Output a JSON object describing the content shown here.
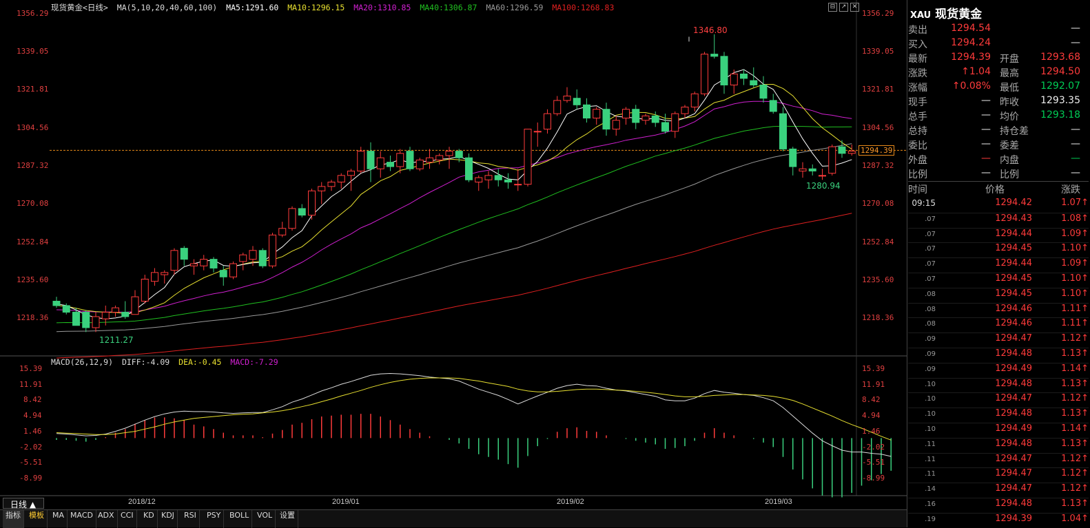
{
  "header": {
    "title": "现货黄金<日线>",
    "ma_params": "MA(5,10,20,40,60,100)",
    "ma5": "MA5:1291.60",
    "ma10": "MA10:1296.15",
    "ma20": "MA20:1310.85",
    "ma40": "MA40:1306.87",
    "ma60": "MA60:1296.59",
    "ma100": "MA100:1268.83"
  },
  "macd_header": {
    "params": "MACD(26,12,9)",
    "diff": "DIFF:-4.09",
    "dea": "DEA:-0.45",
    "macd": "MACD:-7.29"
  },
  "colors": {
    "up": "#ff3b3b",
    "down": "#3ad17e",
    "ma5": "#ffffff",
    "ma10": "#e8e030",
    "ma20": "#d020d0",
    "ma40": "#20c020",
    "ma60": "#9a9a9a",
    "ma100": "#e02020",
    "dea": "#e8e030"
  },
  "chart_data": {
    "type": "candlestick",
    "y_ticks": [
      "1356.29",
      "1339.05",
      "1321.81",
      "1304.56",
      "1287.32",
      "1270.08",
      "1252.84",
      "1235.60",
      "1218.36"
    ],
    "ylim": [
      1205.0,
      1357.5
    ],
    "x_labels": [
      "2018/12",
      "2019/01",
      "2019/02",
      "2019/03"
    ],
    "high_marker": "1346.80",
    "low_marker_left": "1211.27",
    "low_marker_right": "1280.94",
    "current_price": "1294.39",
    "macd_ticks": [
      "15.39",
      "11.91",
      "8.42",
      "4.94",
      "1.46",
      "-2.02",
      "-5.51",
      "-8.99"
    ],
    "macd_ylim": [
      -10.5,
      15.9
    ],
    "candles": [
      [
        1226,
        1228,
        1223,
        1224
      ],
      [
        1224,
        1225,
        1220,
        1221
      ],
      [
        1221,
        1223,
        1215,
        1215
      ],
      [
        1221,
        1222,
        1212,
        1214
      ],
      [
        1214,
        1221,
        1212,
        1219
      ],
      [
        1218,
        1224,
        1215,
        1221
      ],
      [
        1221,
        1224,
        1219,
        1223
      ],
      [
        1221,
        1226,
        1218,
        1219
      ],
      [
        1220,
        1231,
        1220,
        1228
      ],
      [
        1226,
        1238,
        1225,
        1236
      ],
      [
        1235,
        1241,
        1233,
        1239
      ],
      [
        1238,
        1240,
        1234,
        1239
      ],
      [
        1240,
        1250,
        1238,
        1249
      ],
      [
        1250,
        1251,
        1242,
        1245
      ],
      [
        1242,
        1245,
        1238,
        1243
      ],
      [
        1242,
        1247,
        1240,
        1245
      ],
      [
        1245,
        1246,
        1239,
        1241
      ],
      [
        1240,
        1242,
        1233,
        1237
      ],
      [
        1237,
        1244,
        1236,
        1243
      ],
      [
        1244,
        1248,
        1240,
        1247
      ],
      [
        1245,
        1251,
        1242,
        1249
      ],
      [
        1249,
        1250,
        1241,
        1242
      ],
      [
        1242,
        1257,
        1241,
        1256
      ],
      [
        1256,
        1262,
        1255,
        1259
      ],
      [
        1259,
        1269,
        1258,
        1268
      ],
      [
        1268,
        1270,
        1264,
        1265
      ],
      [
        1265,
        1277,
        1263,
        1276
      ],
      [
        1276,
        1280,
        1270,
        1278
      ],
      [
        1278,
        1281,
        1276,
        1280
      ],
      [
        1280,
        1284,
        1277,
        1283
      ],
      [
        1283,
        1286,
        1276,
        1285
      ],
      [
        1285,
        1296,
        1284,
        1294
      ],
      [
        1294,
        1298,
        1280,
        1286
      ],
      [
        1286,
        1294,
        1282,
        1291
      ],
      [
        1289,
        1292,
        1285,
        1287
      ],
      [
        1287,
        1295,
        1284,
        1293
      ],
      [
        1294,
        1296,
        1285,
        1286
      ],
      [
        1286,
        1291,
        1285,
        1290
      ],
      [
        1289,
        1295,
        1286,
        1291
      ],
      [
        1290,
        1293,
        1288,
        1292
      ],
      [
        1292,
        1296,
        1286,
        1294
      ],
      [
        1294,
        1295,
        1289,
        1291
      ],
      [
        1291,
        1293,
        1280,
        1281
      ],
      [
        1280,
        1283,
        1276,
        1282
      ],
      [
        1281,
        1285,
        1277,
        1283
      ],
      [
        1283,
        1286,
        1278,
        1281
      ],
      [
        1281,
        1284,
        1277,
        1280
      ],
      [
        1279,
        1286,
        1276,
        1279
      ],
      [
        1279,
        1304,
        1278,
        1304
      ],
      [
        1303,
        1307,
        1296,
        1303
      ],
      [
        1304,
        1313,
        1302,
        1311
      ],
      [
        1311,
        1319,
        1310,
        1317
      ],
      [
        1317,
        1323,
        1316,
        1319
      ],
      [
        1318,
        1322,
        1313,
        1315
      ],
      [
        1315,
        1318,
        1307,
        1309
      ],
      [
        1309,
        1314,
        1306,
        1313
      ],
      [
        1313,
        1316,
        1301,
        1304
      ],
      [
        1304,
        1310,
        1301,
        1308
      ],
      [
        1309,
        1314,
        1306,
        1313
      ],
      [
        1313,
        1315,
        1304,
        1307
      ],
      [
        1308,
        1311,
        1306,
        1310
      ],
      [
        1310,
        1312,
        1305,
        1307
      ],
      [
        1307,
        1311,
        1302,
        1303
      ],
      [
        1303,
        1312,
        1300,
        1311
      ],
      [
        1311,
        1315,
        1309,
        1314
      ],
      [
        1314,
        1321,
        1312,
        1320
      ],
      [
        1320,
        1339,
        1319,
        1338
      ],
      [
        1338,
        1347,
        1336,
        1337
      ],
      [
        1337,
        1339,
        1320,
        1324
      ],
      [
        1324,
        1331,
        1320,
        1329
      ],
      [
        1329,
        1331,
        1324,
        1327
      ],
      [
        1326,
        1332,
        1323,
        1324
      ],
      [
        1324,
        1328,
        1316,
        1318
      ],
      [
        1317,
        1320,
        1311,
        1312
      ],
      [
        1311,
        1314,
        1294,
        1295
      ],
      [
        1295,
        1296,
        1283,
        1287
      ],
      [
        1285,
        1289,
        1282,
        1286
      ],
      [
        1286,
        1288,
        1283,
        1285
      ],
      [
        1283,
        1286,
        1281,
        1283
      ],
      [
        1284,
        1297,
        1283,
        1296
      ],
      [
        1296,
        1299,
        1291,
        1293
      ],
      [
        1293,
        1297,
        1292,
        1294
      ]
    ],
    "macd_diff": [
      1.0,
      0.9,
      0.7,
      0.5,
      0.6,
      0.9,
      1.5,
      2.2,
      3.1,
      4.0,
      4.8,
      5.4,
      5.8,
      6.0,
      5.9,
      5.9,
      5.8,
      5.6,
      5.5,
      5.6,
      5.7,
      5.7,
      6.3,
      7.0,
      8.0,
      8.7,
      9.6,
      10.5,
      11.2,
      12.0,
      12.6,
      13.3,
      14.0,
      14.3,
      14.4,
      14.3,
      14.1,
      13.9,
      13.6,
      13.4,
      13.2,
      12.7,
      11.8,
      10.9,
      10.2,
      9.5,
      8.6,
      7.6,
      8.5,
      9.4,
      10.2,
      11.1,
      11.7,
      12.0,
      11.7,
      11.6,
      11.1,
      10.7,
      10.5,
      10.1,
      9.7,
      9.3,
      8.5,
      8.3,
      8.3,
      8.9,
      9.9,
      10.6,
      10.2,
      10.0,
      9.7,
      9.5,
      9.0,
      8.3,
      6.8,
      4.9,
      3.0,
      1.1,
      -0.6,
      -1.7,
      -2.7,
      -3.1,
      -3.1,
      -3.4,
      -3.6,
      -4.09
    ],
    "macd_dea": [
      1.2,
      1.1,
      1.0,
      0.9,
      0.8,
      0.8,
      0.9,
      1.2,
      1.5,
      2.0,
      2.5,
      3.1,
      3.6,
      4.0,
      4.4,
      4.6,
      4.8,
      5.0,
      5.2,
      5.3,
      5.4,
      5.6,
      5.8,
      6.1,
      6.5,
      7.0,
      7.5,
      8.1,
      8.7,
      9.4,
      10.0,
      10.6,
      11.3,
      11.9,
      12.4,
      12.8,
      13.1,
      13.3,
      13.4,
      13.4,
      13.4,
      13.3,
      13.0,
      12.7,
      12.3,
      11.9,
      11.5,
      10.9,
      10.5,
      10.3,
      10.3,
      10.4,
      10.6,
      10.8,
      10.9,
      10.9,
      10.8,
      10.7,
      10.6,
      10.4,
      10.2,
      10.0,
      9.7,
      9.4,
      9.2,
      9.2,
      9.3,
      9.5,
      9.6,
      9.7,
      9.7,
      9.6,
      9.5,
      9.3,
      8.9,
      8.4,
      7.6,
      6.7,
      5.8,
      4.9,
      3.9,
      3.0,
      2.2,
      1.3,
      0.4,
      -0.45
    ]
  },
  "quote": {
    "symbol": "XAU",
    "name": "现货黄金",
    "rows": [
      {
        "a": "卖出",
        "b": "1294.54",
        "bc": "red",
        "c": "",
        "d": "—",
        "dc": "wht"
      },
      {
        "a": "买入",
        "b": "1294.24",
        "bc": "red",
        "c": "",
        "d": "—",
        "dc": "wht"
      },
      {
        "a": "最新",
        "b": "1294.39",
        "bc": "red",
        "c": "开盘",
        "d": "1293.68",
        "dc": "red"
      },
      {
        "a": "涨跌",
        "b": "↑1.04",
        "bc": "red",
        "c": "最高",
        "d": "1294.50",
        "dc": "red"
      },
      {
        "a": "涨幅",
        "b": "↑0.08%",
        "bc": "red",
        "c": "最低",
        "d": "1292.07",
        "dc": "grn"
      },
      {
        "a": "现手",
        "b": "—",
        "bc": "wht",
        "c": "昨收",
        "d": "1293.35",
        "dc": "wht"
      },
      {
        "a": "总手",
        "b": "—",
        "bc": "wht",
        "c": "均价",
        "d": "1293.18",
        "dc": "grn"
      },
      {
        "a": "总持",
        "b": "—",
        "bc": "wht",
        "c": "持仓差",
        "d": "—",
        "dc": "wht"
      },
      {
        "a": "委比",
        "b": "—",
        "bc": "wht",
        "c": "委差",
        "d": "—",
        "dc": "wht"
      },
      {
        "a": "外盘",
        "b": "—",
        "bc": "red",
        "c": "内盘",
        "d": "—",
        "dc": "grn"
      },
      {
        "a": "比例",
        "b": "—",
        "bc": "wht",
        "c": "比例",
        "d": "—",
        "dc": "wht"
      }
    ],
    "ticks_header": {
      "time": "时间",
      "price": "价格",
      "change": "涨跌"
    },
    "ticks": [
      {
        "t": "09:15",
        "p": "1294.42",
        "c": "1.07↑"
      },
      {
        "t": ".07",
        "p": "1294.43",
        "c": "1.08↑"
      },
      {
        "t": ".07",
        "p": "1294.44",
        "c": "1.09↑"
      },
      {
        "t": ".07",
        "p": "1294.45",
        "c": "1.10↑"
      },
      {
        "t": ".07",
        "p": "1294.44",
        "c": "1.09↑"
      },
      {
        "t": ".07",
        "p": "1294.45",
        "c": "1.10↑"
      },
      {
        "t": ".08",
        "p": "1294.45",
        "c": "1.10↑"
      },
      {
        "t": ".08",
        "p": "1294.46",
        "c": "1.11↑"
      },
      {
        "t": ".08",
        "p": "1294.46",
        "c": "1.11↑"
      },
      {
        "t": ".09",
        "p": "1294.47",
        "c": "1.12↑"
      },
      {
        "t": ".09",
        "p": "1294.48",
        "c": "1.13↑"
      },
      {
        "t": ".09",
        "p": "1294.49",
        "c": "1.14↑"
      },
      {
        "t": ".10",
        "p": "1294.48",
        "c": "1.13↑"
      },
      {
        "t": ".10",
        "p": "1294.47",
        "c": "1.12↑"
      },
      {
        "t": ".10",
        "p": "1294.48",
        "c": "1.13↑"
      },
      {
        "t": ".10",
        "p": "1294.49",
        "c": "1.14↑"
      },
      {
        "t": ".11",
        "p": "1294.48",
        "c": "1.13↑"
      },
      {
        "t": ".11",
        "p": "1294.47",
        "c": "1.12↑"
      },
      {
        "t": ".11",
        "p": "1294.47",
        "c": "1.12↑"
      },
      {
        "t": ".14",
        "p": "1294.47",
        "c": "1.12↑"
      },
      {
        "t": ".16",
        "p": "1294.48",
        "c": "1.13↑"
      },
      {
        "t": ".19",
        "p": "1294.39",
        "c": "1.04↑"
      }
    ]
  },
  "bottom": {
    "period": "日线 ▲",
    "tabs": [
      "指标",
      "模板",
      "MA",
      "MACD",
      "ADX",
      "CCI",
      "KD",
      "KDJ",
      "RSI",
      "PSY",
      "BOLL",
      "VOL",
      "设置"
    ]
  }
}
